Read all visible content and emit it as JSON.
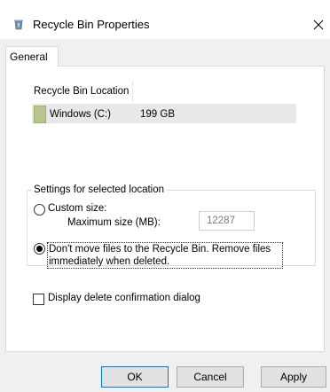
{
  "window": {
    "title": "Recycle Bin Properties"
  },
  "tabs": [
    {
      "label": "General",
      "selected": true
    }
  ],
  "location_list": {
    "header": "Recycle Bin Location",
    "rows": [
      {
        "name": "Windows (C:)",
        "size": "199 GB",
        "selected": true
      }
    ]
  },
  "settings": {
    "group_label": "Settings for selected location",
    "custom_size": {
      "label": "Custom size:",
      "checked": false,
      "max_label": "Maximum size (MB):",
      "max_value": "12287"
    },
    "no_move": {
      "label": "Don't move files to the Recycle Bin. Remove files immediately when deleted.",
      "checked": true
    }
  },
  "confirm_dialog": {
    "label": "Display delete confirmation dialog",
    "checked": false
  },
  "buttons": {
    "ok": "OK",
    "cancel": "Cancel",
    "apply": "Apply"
  },
  "icons": {
    "title_icon": "recycle-bin-icon",
    "close": "close-icon",
    "drive": "drive-icon"
  },
  "colors": {
    "default_button_border": "#0078d7",
    "drive_icon": "#b5c58b"
  }
}
